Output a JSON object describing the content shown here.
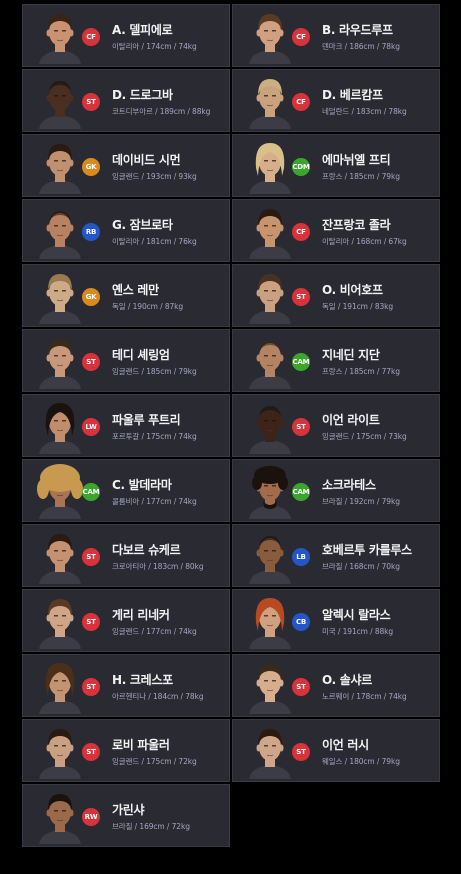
{
  "position_colors": {
    "CF": "#d8323a",
    "ST": "#d8323a",
    "LW": "#d8323a",
    "RW": "#d8323a",
    "GK": "#d88a1c",
    "CDM": "#3aa72c",
    "CAM": "#3aa72c",
    "RB": "#2456c8",
    "LB": "#2456c8",
    "CB": "#2456c8"
  },
  "players": [
    {
      "name": "A. 델피에로",
      "position": "CF",
      "details": "이탈리아 / 174cm / 74kg",
      "skin": "#c99270",
      "hair": "#3a2418",
      "hair_style": "short"
    },
    {
      "name": "B. 라우드루프",
      "position": "CF",
      "details": "덴마크 / 186cm / 78kg",
      "skin": "#d0a080",
      "hair": "#5a3a22",
      "hair_style": "short"
    },
    {
      "name": "D. 드로그바",
      "position": "ST",
      "details": "코트디부아르 / 189cm / 88kg",
      "skin": "#4a2e20",
      "hair": "#1a100a",
      "hair_style": "bald"
    },
    {
      "name": "D. 베르캄프",
      "position": "CF",
      "details": "네덜란드 / 183cm / 78kg",
      "skin": "#caa27e",
      "hair": "#c9b080",
      "hair_style": "short"
    },
    {
      "name": "데이비드 시먼",
      "position": "GK",
      "details": "잉글랜드 / 193cm / 93kg",
      "skin": "#c09070",
      "hair": "#2a1a10",
      "hair_style": "short"
    },
    {
      "name": "에마뉘엘 프티",
      "position": "CDM",
      "details": "프랑스 / 185cm / 79kg",
      "skin": "#d6ae8a",
      "hair": "#d8c088",
      "hair_style": "long"
    },
    {
      "name": "G. 잠브로타",
      "position": "RB",
      "details": "이탈리아 / 181cm / 76kg",
      "skin": "#b88262",
      "hair": "#2a1a10",
      "hair_style": "bald"
    },
    {
      "name": "잔프랑코 졸라",
      "position": "CF",
      "details": "이탈리아 / 168cm / 67kg",
      "skin": "#c8946e",
      "hair": "#2a1a10",
      "hair_style": "short"
    },
    {
      "name": "옌스 레만",
      "position": "GK",
      "details": "독일 / 190cm / 87kg",
      "skin": "#ceaa88",
      "hair": "#9a7a50",
      "hair_style": "short"
    },
    {
      "name": "O. 비어호프",
      "position": "ST",
      "details": "독일 / 191cm / 83kg",
      "skin": "#caa080",
      "hair": "#4a3020",
      "hair_style": "short"
    },
    {
      "name": "테디 셰링엄",
      "position": "ST",
      "details": "잉글랜드 / 185cm / 79kg",
      "skin": "#c8987a",
      "hair": "#3a2a1a",
      "hair_style": "short"
    },
    {
      "name": "지네딘 지단",
      "position": "CAM",
      "details": "프랑스 / 185cm / 77kg",
      "skin": "#b48462",
      "hair": "#3a2a1a",
      "hair_style": "bald"
    },
    {
      "name": "파울루 푸트리",
      "position": "LW",
      "details": "포르투갈 / 175cm / 74kg",
      "skin": "#c08e6c",
      "hair": "#1a120c",
      "hair_style": "long"
    },
    {
      "name": "이언 라이트",
      "position": "ST",
      "details": "잉글랜드 / 175cm / 73kg",
      "skin": "#3e2418",
      "hair": "#1a100a",
      "hair_style": "bald"
    },
    {
      "name": "C. 발데라마",
      "position": "CAM",
      "details": "콜롬비아 / 177cm / 74kg",
      "skin": "#a87454",
      "hair": "#c89a50",
      "hair_style": "afro"
    },
    {
      "name": "소크라테스",
      "position": "CAM",
      "details": "브라질 / 192cm / 79kg",
      "skin": "#a06c4c",
      "hair": "#1a120c",
      "hair_style": "curly"
    },
    {
      "name": "다보르 슈케르",
      "position": "ST",
      "details": "크로아티아 / 183cm / 80kg",
      "skin": "#c49270",
      "hair": "#2a1a10",
      "hair_style": "short"
    },
    {
      "name": "호베르투 카를루스",
      "position": "LB",
      "details": "브라질 / 168cm / 70kg",
      "skin": "#8a5c3e",
      "hair": "#1a120c",
      "hair_style": "bald"
    },
    {
      "name": "게리 리네커",
      "position": "ST",
      "details": "잉글랜드 / 177cm / 74kg",
      "skin": "#d0a486",
      "hair": "#5a3a22",
      "hair_style": "short"
    },
    {
      "name": "알렉시 랄라스",
      "position": "CB",
      "details": "미국 / 191cm / 88kg",
      "skin": "#d0a080",
      "hair": "#b84a20",
      "hair_style": "long"
    },
    {
      "name": "H. 크레스포",
      "position": "ST",
      "details": "아르헨티나 / 184cm / 78kg",
      "skin": "#c49472",
      "hair": "#4a3018",
      "hair_style": "long"
    },
    {
      "name": "O. 솔샤르",
      "position": "ST",
      "details": "노르웨이 / 178cm / 74kg",
      "skin": "#d6ae8e",
      "hair": "#3a2a1a",
      "hair_style": "short"
    },
    {
      "name": "로비 파울러",
      "position": "ST",
      "details": "잉글랜드 / 175cm / 72kg",
      "skin": "#caa082",
      "hair": "#2a1a10",
      "hair_style": "short"
    },
    {
      "name": "이언 러시",
      "position": "ST",
      "details": "웨일스 / 180cm / 79kg",
      "skin": "#d0a688",
      "hair": "#2a1a10",
      "hair_style": "short"
    },
    {
      "name": "가린샤",
      "position": "RW",
      "details": "브라질 / 169cm / 72kg",
      "skin": "#9a6a4a",
      "hair": "#1a120c",
      "hair_style": "short"
    }
  ]
}
